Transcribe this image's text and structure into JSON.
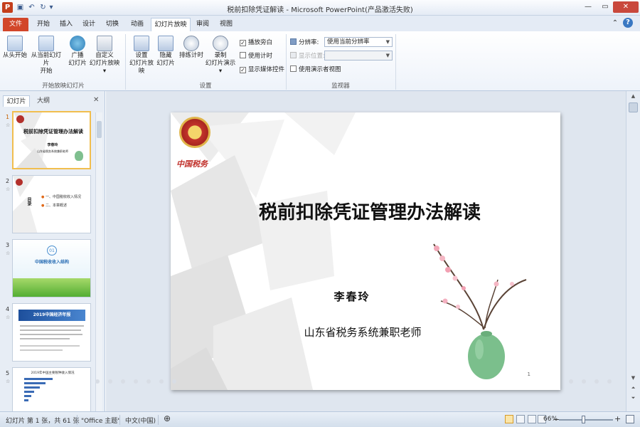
{
  "window": {
    "title": "税前扣除凭证解读 - Microsoft PowerPoint(产品激活失败)",
    "app_logo": "P"
  },
  "qat": {
    "icons": [
      "save-icon",
      "undo-icon",
      "redo-icon"
    ]
  },
  "tabs": [
    "文件",
    "开始",
    "插入",
    "设计",
    "切换",
    "动画",
    "幻灯片放映",
    "审阅",
    "视图"
  ],
  "ribbon": {
    "start_group": {
      "label": "开始放映幻灯片",
      "buttons": [
        "从头开始",
        "从当前幻灯片",
        "开始",
        "广播",
        "幻灯片",
        "自定义",
        "幻灯片放映"
      ]
    },
    "setup_group": {
      "label": "设置",
      "buttons": [
        "设置",
        "幻灯片放映",
        "隐藏",
        "幻灯片",
        "排练计时",
        "录制",
        "幻灯片演示"
      ],
      "checkboxes": [
        {
          "label": "播放旁白",
          "checked": true
        },
        {
          "label": "使用计时",
          "checked": false
        },
        {
          "label": "显示媒体控件",
          "checked": true
        }
      ]
    },
    "monitor_group": {
      "label": "监视器",
      "resolution_label": "分辨率:",
      "resolution_value": "使用当前分辨率",
      "display_label": "显示位置:",
      "display_value": "",
      "presenter_view": {
        "label": "使用演示者视图",
        "checked": false
      }
    }
  },
  "panel": {
    "tabs": [
      "幻灯片",
      "大纲"
    ],
    "thumbs": [
      {
        "num": "1",
        "title": "税前扣除凭证管理办法解读",
        "sub1": "李春玲",
        "sub2": "山东省税务系统兼职老师"
      },
      {
        "num": "2",
        "label": "目录",
        "items": [
          "一、中国税收收入情况",
          "二、本章概述"
        ]
      },
      {
        "num": "3",
        "circle": "01",
        "label": "中国税收收入结构"
      },
      {
        "num": "4",
        "header": "2019中国经济年报"
      },
      {
        "num": "5",
        "header": "2019年中国主要税种收入情况"
      }
    ]
  },
  "slide": {
    "seal_text": "中国税务",
    "title": "税前扣除凭证管理办法解读",
    "author": "李春玲",
    "org": "山东省税务系统兼职老师",
    "page_number": "1"
  },
  "status": {
    "slide_info": "幻灯片 第 1 张，共 61 张",
    "theme": "\"Office 主题\"",
    "language": "中文(中国)",
    "zoom": "66%",
    "zoom_minus": "−",
    "zoom_plus": "+"
  }
}
